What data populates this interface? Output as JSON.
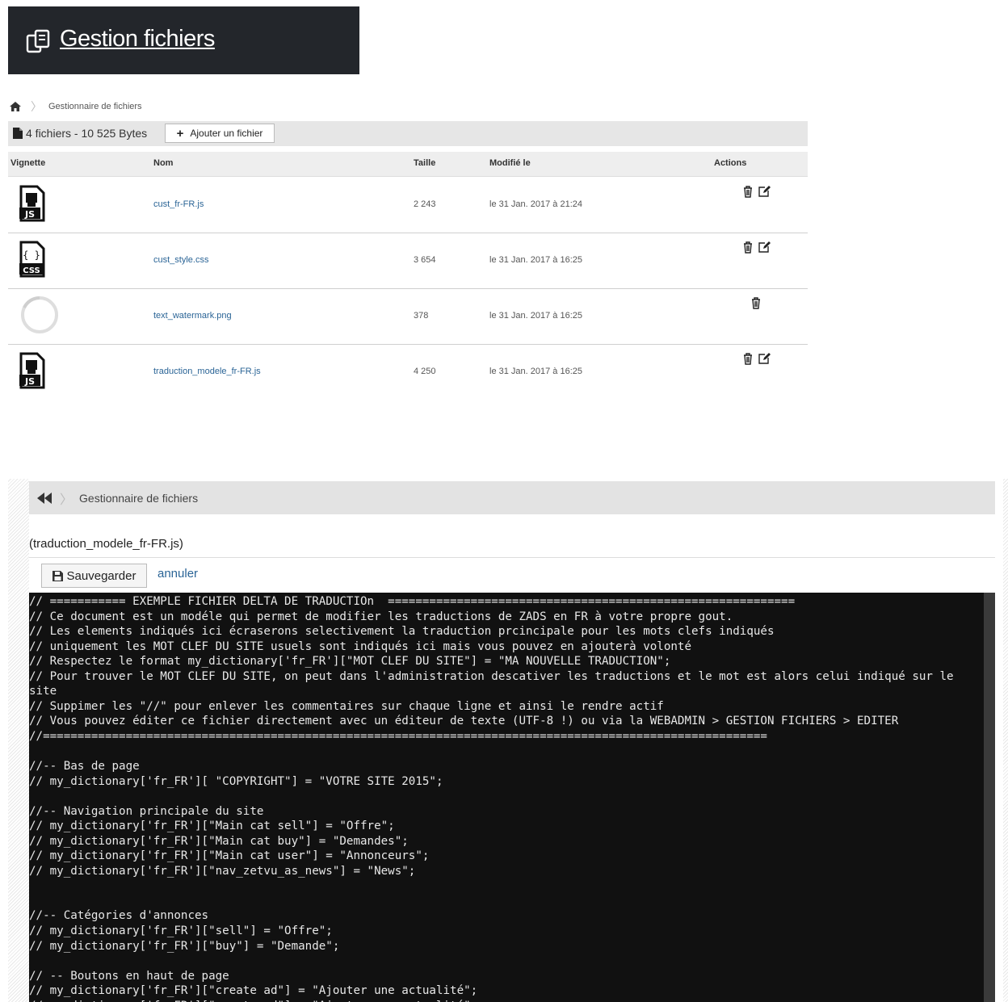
{
  "header": {
    "title": "Gestion fichiers",
    "icon": "copy-files-icon"
  },
  "breadcrumb1": {
    "home_icon": "home-icon",
    "label": "Gestionnaire de fichiers"
  },
  "toolbar": {
    "summary": "4 fichiers - 10 525 Bytes",
    "add_label": "Ajouter un fichier"
  },
  "table": {
    "headers": {
      "thumb": "Vignette",
      "name": "Nom",
      "size": "Taille",
      "modified": "Modifié le",
      "actions": "Actions"
    },
    "rows": [
      {
        "thumb": "js-file-icon",
        "name": "cust_fr-FR.js",
        "size": "2 243",
        "modified": "le 31 Jan. 2017 à 21:24",
        "actions": [
          "delete",
          "edit"
        ]
      },
      {
        "thumb": "css-file-icon",
        "name": "cust_style.css",
        "size": "3 654",
        "modified": "le 31 Jan. 2017 à 16:25",
        "actions": [
          "delete",
          "edit"
        ]
      },
      {
        "thumb": "loading-spinner-icon",
        "name": "text_watermark.png",
        "size": "378",
        "modified": "le 31 Jan. 2017 à 16:25",
        "actions": [
          "delete"
        ]
      },
      {
        "thumb": "js-file-icon",
        "name": "traduction_modele_fr-FR.js",
        "size": "4 250",
        "modified": "le 31 Jan. 2017 à 16:25",
        "actions": [
          "delete",
          "edit"
        ]
      }
    ]
  },
  "editor": {
    "breadcrumb_label": "Gestionnaire de fichiers",
    "file_title": "(traduction_modele_fr-FR.js)",
    "save_label": "Sauvegarder",
    "cancel_label": "annuler",
    "code": "// =========== EXEMPLE FICHIER DELTA DE TRADUCTIOn  ===========================================================\n// Ce document est un modéle qui permet de modifier les traductions de ZADS en FR à votre propre gout.\n// Les elements indiqués ici écraserons selectivement la traduction prcincipale pour les mots clefs indiqués\n// uniquement les MOT CLEF DU SITE usuels sont indiqués ici mais vous pouvez en ajouterà volonté\n// Respectez le format my_dictionary['fr_FR'][\"MOT CLEF DU SITE\"] = \"MA NOUVELLE TRADUCTION\";\n// Pour trouver le MOT CLEF DU SITE, on peut dans l'administration descativer les traductions et le mot est alors celui indiqué sur le\nsite\n// Suppimer les \"//\" pour enlever les commentaires sur chaque ligne et ainsi le rendre actif\n// Vous pouvez éditer ce fichier directement avec un éditeur de texte (UTF-8 !) ou via la WEBADMIN > GESTION FICHIERS > EDITER\n//=========================================================================================================\n\n//-- Bas de page\n// my_dictionary['fr_FR'][ \"COPYRIGHT\"] = \"VOTRE SITE 2015\";\n\n//-- Navigation principale du site\n// my_dictionary['fr_FR'][\"Main cat sell\"] = \"Offre\";\n// my_dictionary['fr_FR'][\"Main cat buy\"] = \"Demandes\";\n// my_dictionary['fr_FR'][\"Main cat user\"] = \"Annonceurs\";\n// my_dictionary['fr_FR'][\"nav_zetvu_as_news\"] = \"News\";\n\n\n//-- Catégories d'annonces\n// my_dictionary['fr_FR'][\"sell\"] = \"Offre\";\n// my_dictionary['fr_FR'][\"buy\"] = \"Demande\";\n\n// -- Boutons en haut de page\n// my_dictionary['fr_FR'][\"create ad\"] = \"Ajouter une actualité\";\n// my_dictionary['fr_FR'][\"create ad\"] = \"Ajouter une actualité\";"
  }
}
